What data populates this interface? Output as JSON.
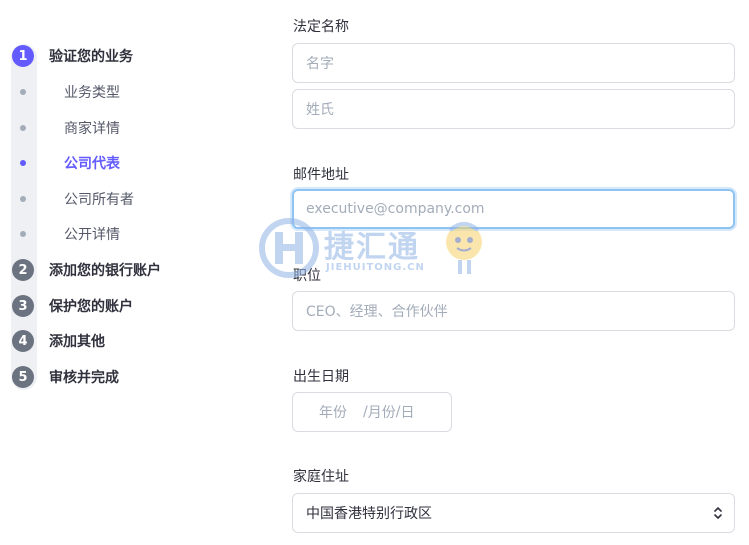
{
  "sidebar": {
    "steps": [
      {
        "number": "1",
        "label": "验证您的业务",
        "active": true
      },
      {
        "number": "2",
        "label": "添加您的银行账户"
      },
      {
        "number": "3",
        "label": "保护您的账户"
      },
      {
        "number": "4",
        "label": "添加其他"
      },
      {
        "number": "5",
        "label": "审核并完成"
      }
    ],
    "substeps": [
      {
        "label": "业务类型"
      },
      {
        "label": "商家详情"
      },
      {
        "label": "公司代表",
        "active": true
      },
      {
        "label": "公司所有者"
      },
      {
        "label": "公开详情"
      }
    ]
  },
  "form": {
    "legal_name": {
      "label": "法定名称",
      "first_placeholder": "名字",
      "last_placeholder": "姓氏"
    },
    "email": {
      "label": "邮件地址",
      "placeholder": "executive@company.com"
    },
    "title": {
      "label": "职位",
      "placeholder": "CEO、经理、合作伙伴"
    },
    "dob": {
      "label": "出生日期",
      "year_placeholder": "年份",
      "sep1": "/",
      "month_placeholder": "月份",
      "sep2": "/",
      "day_placeholder": "日"
    },
    "address": {
      "label": "家庭住址",
      "country_value": "中国香港特别行政区"
    }
  },
  "watermark": {
    "text": "捷汇通",
    "subtext": "JIEHUITONG.CN"
  },
  "colors": {
    "accent": "#635bff",
    "step_inactive": "#6b7280",
    "focus_ring": "#8fc3f2"
  }
}
